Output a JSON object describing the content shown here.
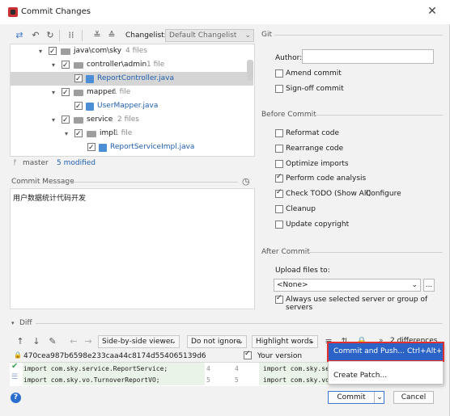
{
  "window": {
    "title": "Commit Changes"
  },
  "toolbar": {
    "changelist_label": "Changelist:",
    "changelist_value": "Default Changelist"
  },
  "tree": {
    "rows": [
      {
        "name": "java\\com\\sky",
        "count": "4 files"
      },
      {
        "name": "controller\\admin",
        "count": "1 file"
      },
      {
        "name": "ReportController.java",
        "count": ""
      },
      {
        "name": "mapper",
        "count": "1 file"
      },
      {
        "name": "UserMapper.java",
        "count": ""
      },
      {
        "name": "service",
        "count": "2 files"
      },
      {
        "name": "impl",
        "count": "1 file"
      },
      {
        "name": "ReportServiceImpl.java",
        "count": ""
      }
    ]
  },
  "status": {
    "branch": "master",
    "modified": "5 modified"
  },
  "commit_message": {
    "label": "Commit Message",
    "text": "用户数据统计代码开发"
  },
  "git": {
    "section": "Git",
    "author_label": "Author:",
    "author_value": "",
    "amend": "Amend commit",
    "signoff": "Sign-off commit"
  },
  "before_commit": {
    "section": "Before Commit",
    "options": [
      {
        "label": "Reformat code",
        "checked": false
      },
      {
        "label": "Rearrange code",
        "checked": false
      },
      {
        "label": "Optimize imports",
        "checked": false
      },
      {
        "label": "Perform code analysis",
        "checked": true
      },
      {
        "label": "Check TODO (Show All)",
        "checked": true,
        "link": "Configure"
      },
      {
        "label": "Cleanup",
        "checked": false
      },
      {
        "label": "Update copyright",
        "checked": false
      }
    ]
  },
  "after_commit": {
    "section": "After Commit",
    "upload_label": "Upload files to:",
    "upload_value": "<None>",
    "more_button": "...",
    "always_use": "Always use selected server or group of servers"
  },
  "diff": {
    "section": "Diff",
    "viewer": "Side-by-side viewer",
    "ignore": "Do not ignore",
    "highlight": "Highlight words",
    "differences": "2 differences",
    "hash": "470cea987b6598e233caa44c8174d554065139d6",
    "your_version": "Your version",
    "left_lines": [
      {
        "text": "import com.sky.service.ReportService;",
        "num": "4"
      },
      {
        "text": "import com.sky.vo.TurnoverReportVO;",
        "num": "5"
      }
    ],
    "right_lines": [
      {
        "text": "import com.sky.ser",
        "num": "4"
      },
      {
        "text": "import com.sky.vo.",
        "num": "5"
      }
    ]
  },
  "menu": {
    "commit_push": "Commit and Push...",
    "commit_push_shortcut": "Ctrl+Alt+K",
    "create_patch": "Create Patch..."
  },
  "buttons": {
    "commit": "Commit",
    "cancel": "Cancel",
    "help": "?"
  },
  "colors": {
    "accent": "#2b63c6",
    "highlight_outline": "#e03030",
    "link": "#2060b0"
  }
}
